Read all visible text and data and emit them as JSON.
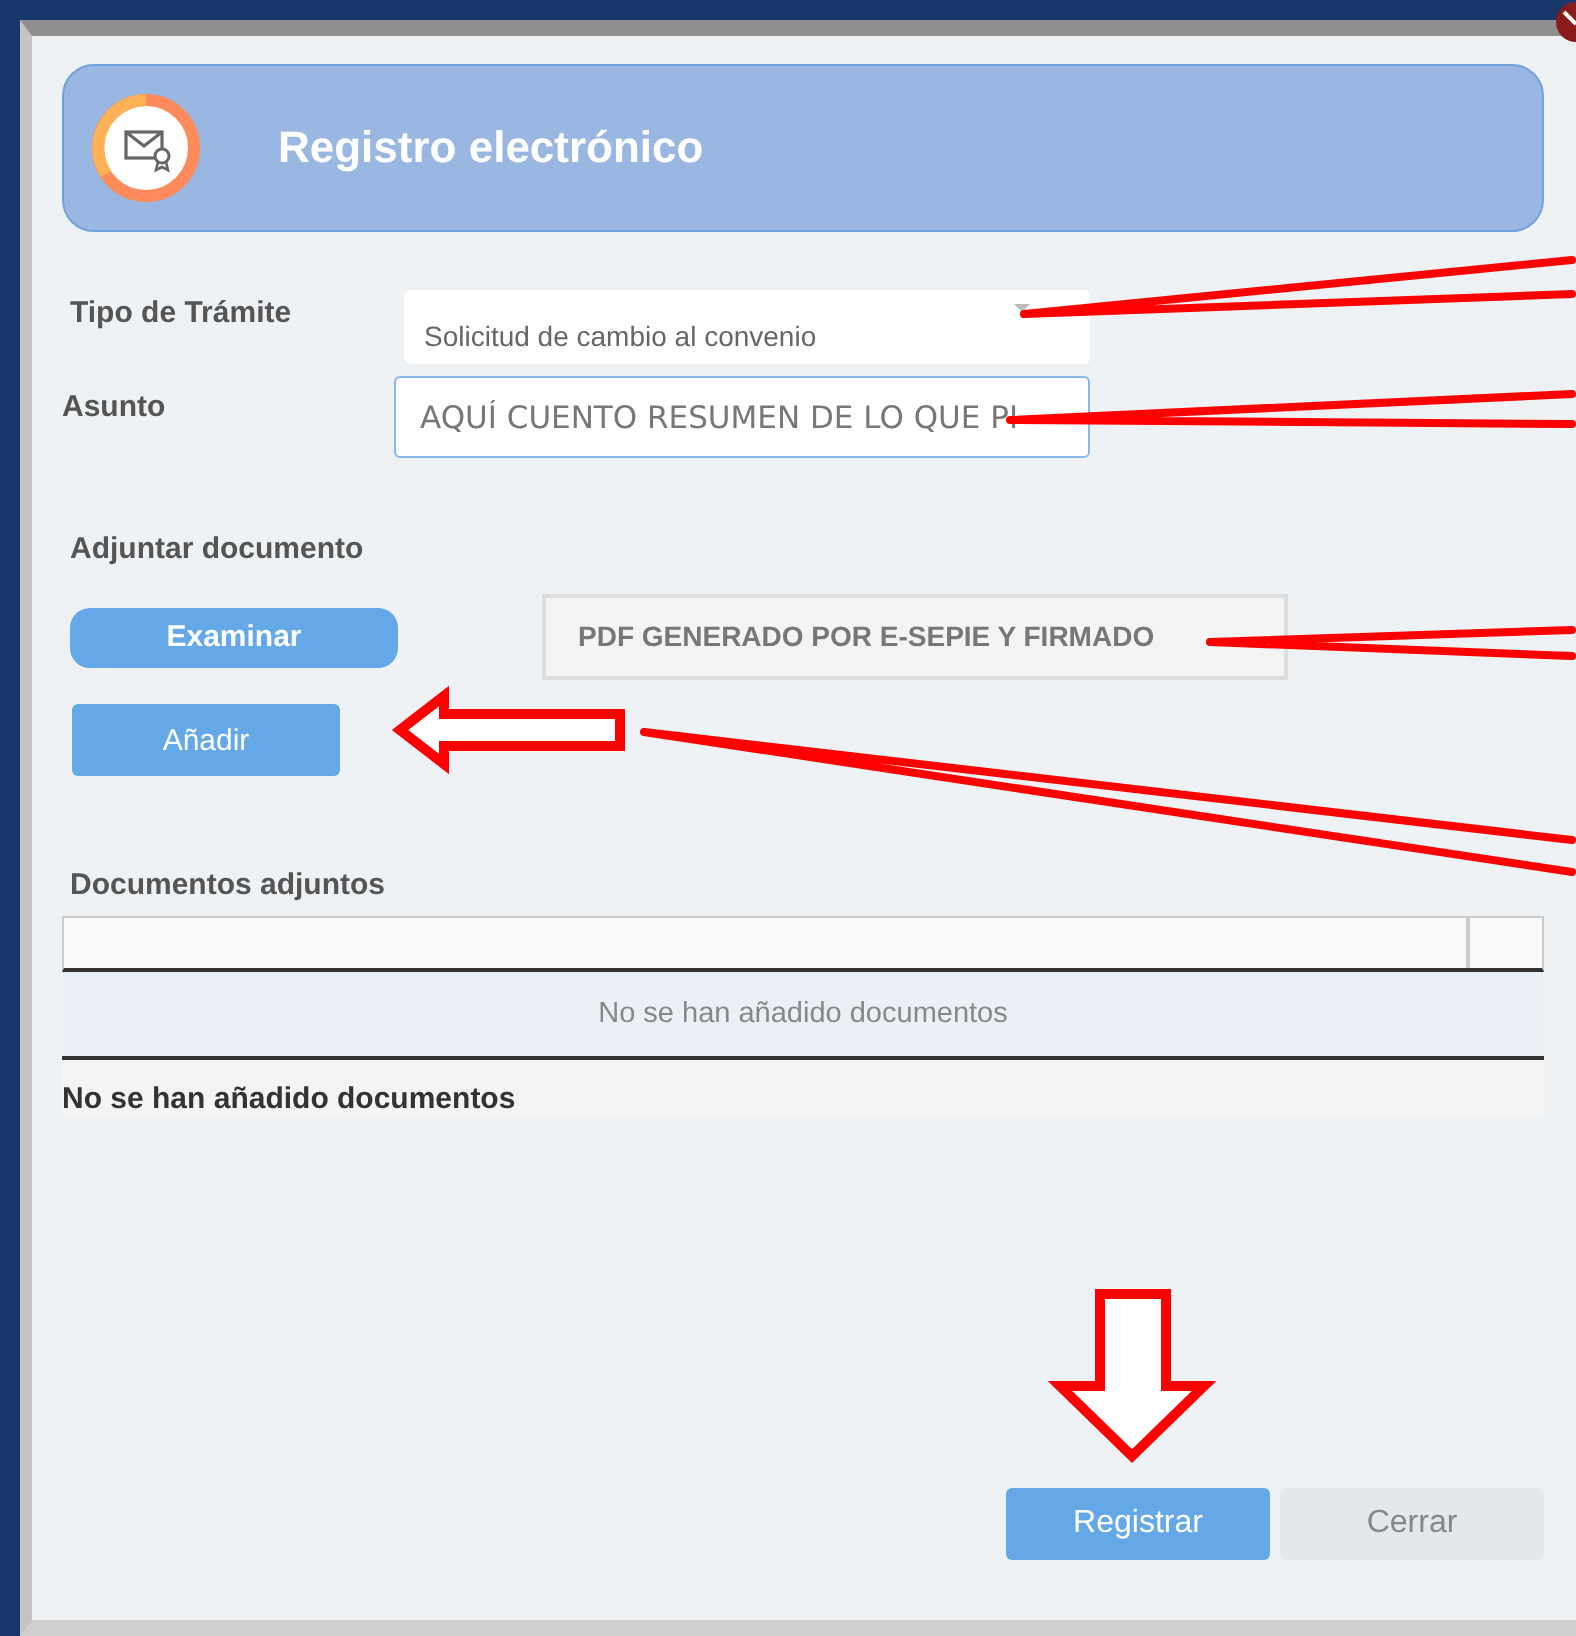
{
  "window": {
    "title": "Registro electrónico"
  },
  "form": {
    "fields": [
      {
        "kind": "select",
        "label": "Tipo de Trámite",
        "value": "Solicitud de cambio al convenio"
      },
      {
        "kind": "text",
        "label": "Asunto",
        "value": "AQUÍ CUENTO RESUMEN DE LO QUE PI"
      }
    ]
  },
  "attachment": {
    "label": "Adjuntar documento",
    "browse_button": "Examinar",
    "file_name": "PDF GENERADO POR E-SEPIE Y FIRMADO",
    "add_button": "Añadir"
  },
  "documents": {
    "title": "Documentos adjuntos",
    "empty_message": "No se han añadido documentos",
    "footer": "No se han añadido documentos"
  },
  "buttons": [
    {
      "label": "Registrar",
      "kind": "primary"
    },
    {
      "label": "Cerrar",
      "kind": "secondary"
    }
  ]
}
